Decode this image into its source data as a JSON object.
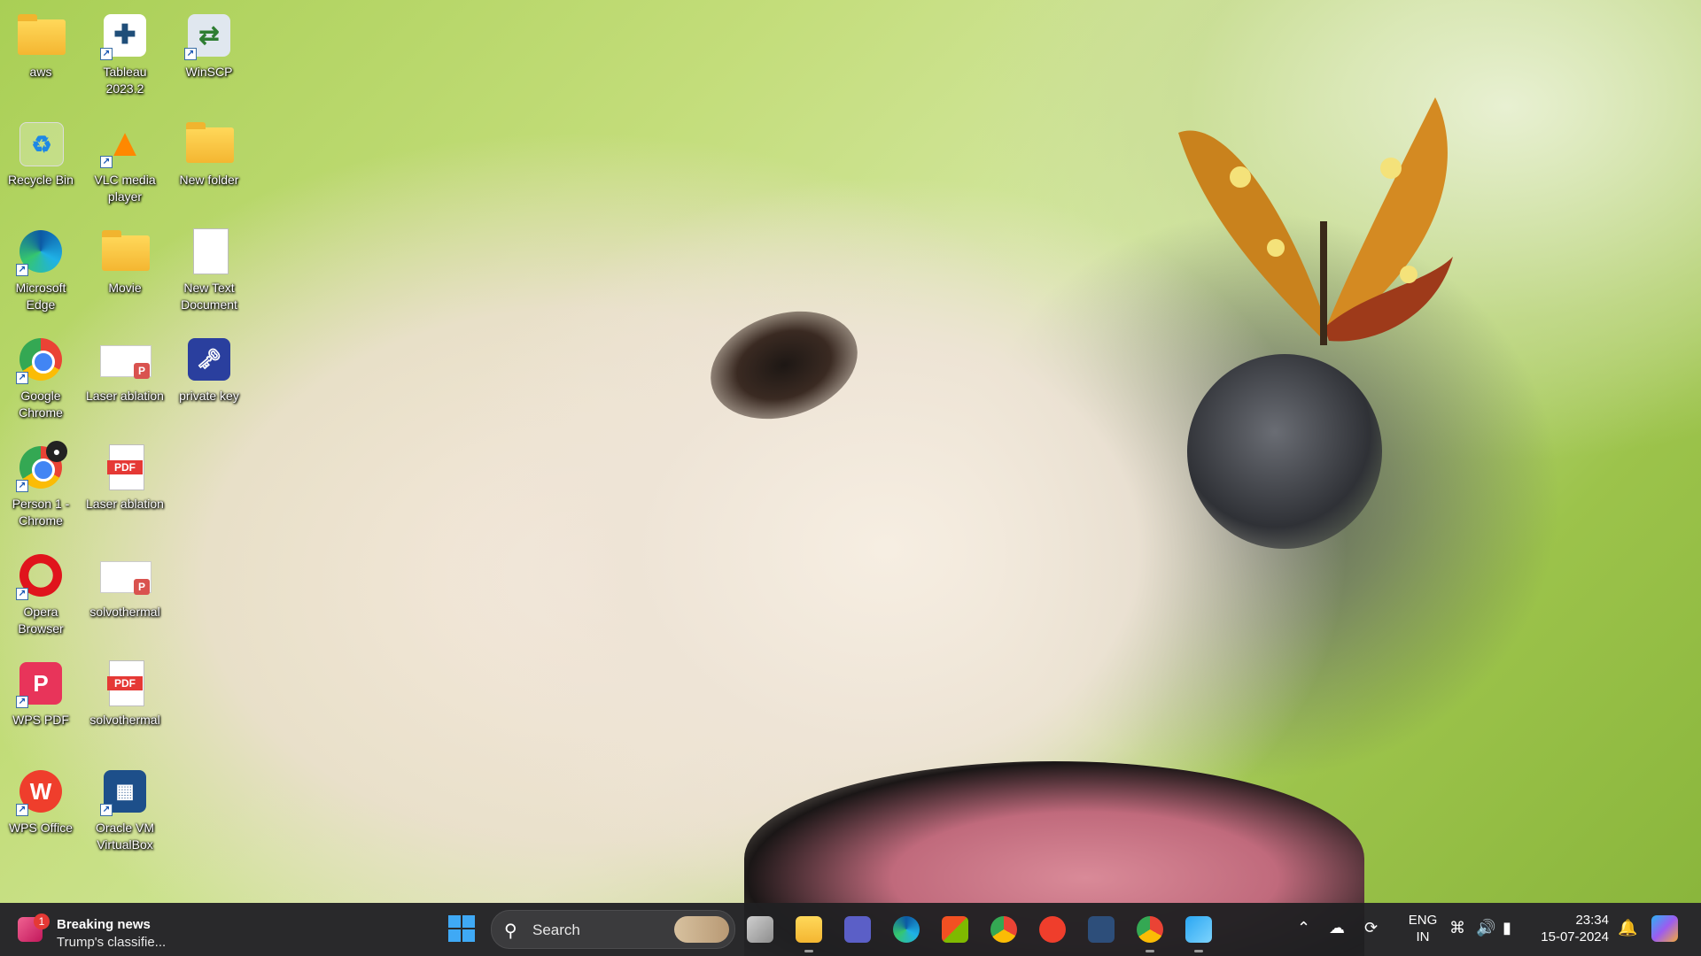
{
  "desktop": {
    "icons": [
      {
        "label": "aws",
        "icon": "folder-icon"
      },
      {
        "label": "Tableau 2023.2",
        "icon": "tableau-icon"
      },
      {
        "label": "WinSCP",
        "icon": "winscp-icon"
      },
      {
        "label": "Recycle Bin",
        "icon": "recycle-bin-icon"
      },
      {
        "label": "VLC media player",
        "icon": "vlc-icon"
      },
      {
        "label": "New folder",
        "icon": "folder-icon"
      },
      {
        "label": "Microsoft Edge",
        "icon": "edge-icon"
      },
      {
        "label": "Movie",
        "icon": "folder-icon"
      },
      {
        "label": "New Text Document",
        "icon": "text-document-icon"
      },
      {
        "label": "Google Chrome",
        "icon": "chrome-icon"
      },
      {
        "label": "Laser ablation",
        "icon": "powerpoint-file-icon"
      },
      {
        "label": "private key",
        "icon": "putty-key-icon"
      },
      {
        "label": "Person 1 - Chrome",
        "icon": "chrome-profile-icon"
      },
      {
        "label": "Laser ablation",
        "icon": "pdf-file-icon"
      },
      {
        "label": "Opera Browser",
        "icon": "opera-icon"
      },
      {
        "label": "solvothermal",
        "icon": "powerpoint-file-icon"
      },
      {
        "label": "WPS PDF",
        "icon": "wps-pdf-icon"
      },
      {
        "label": "solvothermal",
        "icon": "pdf-file-icon"
      },
      {
        "label": "WPS Office",
        "icon": "wps-office-icon"
      },
      {
        "label": "Oracle VM VirtualBox",
        "icon": "virtualbox-icon"
      }
    ]
  },
  "taskbar": {
    "news": {
      "headline": "Breaking news",
      "sub": "Trump's classifie...",
      "badge": "1"
    },
    "search_label": "Search",
    "apps": [
      "task-view-icon",
      "file-explorer-icon",
      "teams-icon",
      "edge-icon",
      "microsoft-store-icon",
      "chrome-icon",
      "wps-office-icon",
      "tableau-icon",
      "chrome-profile-icon",
      "photos-icon"
    ],
    "tray": {
      "lang_line1": "ENG",
      "lang_line2": "IN",
      "time": "23:34",
      "date": "15-07-2024"
    }
  },
  "colors": {
    "taskbar_bg": "#202022",
    "accent_blue": "#3fa9f5",
    "folder_yellow": "#f4b631"
  }
}
